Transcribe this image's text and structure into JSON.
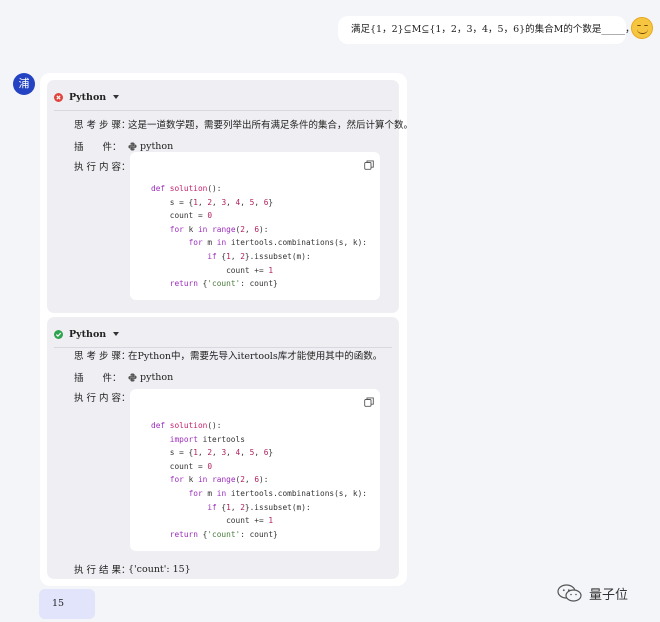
{
  "user_message": "满足{1，2}⊆M⊆{1，2，3，4，5，6}的集合M的个数是_____，'.",
  "bot_avatar_char": "浦",
  "tool_calls": [
    {
      "status": "error",
      "tool_name": "Python",
      "steps_label": "思 考 步 骤：",
      "steps_text": "这是一道数学题，需要列举出所有满足条件的集合，然后计算个数。",
      "plugin_label": "插　　件：",
      "plugin_name": "python",
      "code_label": "执 行 内 容："
    },
    {
      "status": "success",
      "tool_name": "Python",
      "steps_label": "思 考 步 骤：",
      "steps_text": "在Python中，需要先导入itertools库才能使用其中的函数。",
      "plugin_label": "插　　件：",
      "plugin_name": "python",
      "code_label": "执 行 内 容：",
      "result_label": "执 行 结 果：",
      "result_text": "{'count': 15}"
    }
  ],
  "final_answer": "15",
  "watermark_text": "量子位",
  "icons": [
    "smiley-avatar-icon",
    "error-status-icon",
    "success-status-icon",
    "dropdown-caret-icon",
    "python-plugin-icon",
    "copy-icon",
    "wechat-icon"
  ],
  "colors": {
    "background": "#f4f5f9",
    "bot_avatar": "#2343c2",
    "error": "#e0443c",
    "success": "#2ea44f",
    "final_bubble": "#e1e4fa"
  }
}
